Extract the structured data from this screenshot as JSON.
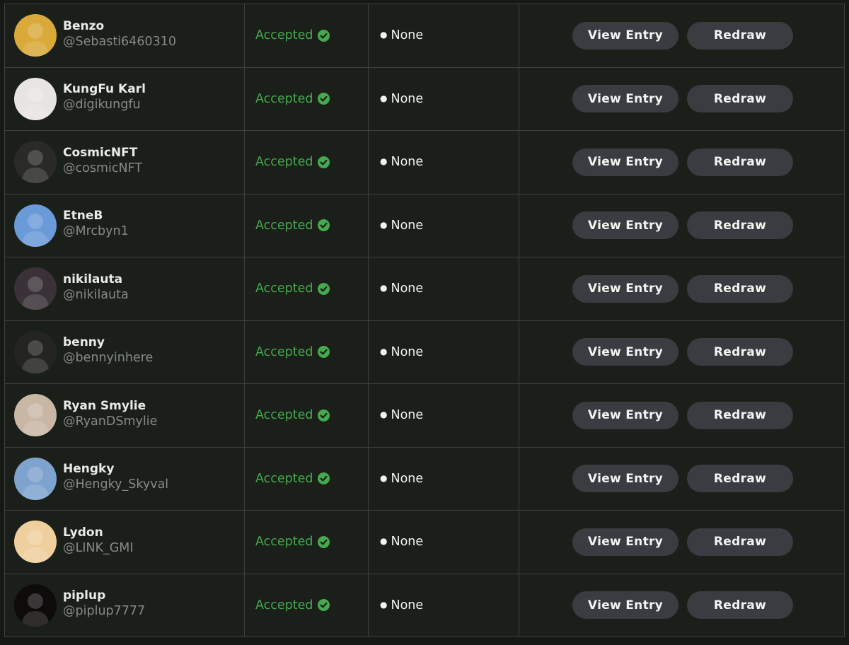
{
  "colors": {
    "background": "#1a1f19",
    "border": "#3c423d",
    "accepted": "#46a84f",
    "button": "#393d42"
  },
  "entries": [
    {
      "name": "Benzo",
      "handle": "@Sebasti6460310",
      "status": "Accepted",
      "other": "None",
      "view_label": "View Entry",
      "redraw_label": "Redraw",
      "avatar_color": "#d9a93a"
    },
    {
      "name": "KungFu Karl",
      "handle": "@digikungfu",
      "status": "Accepted",
      "other": "None",
      "view_label": "View Entry",
      "redraw_label": "Redraw",
      "avatar_color": "#e8e4e2"
    },
    {
      "name": "CosmicNFT",
      "handle": "@cosmicNFT",
      "status": "Accepted",
      "other": "None",
      "view_label": "View Entry",
      "redraw_label": "Redraw",
      "avatar_color": "#2a2a28"
    },
    {
      "name": "EtneB",
      "handle": "@Mrcbyn1",
      "status": "Accepted",
      "other": "None",
      "view_label": "View Entry",
      "redraw_label": "Redraw",
      "avatar_color": "#6a9ad8"
    },
    {
      "name": "nikilauta",
      "handle": "@nikilauta",
      "status": "Accepted",
      "other": "None",
      "view_label": "View Entry",
      "redraw_label": "Redraw",
      "avatar_color": "#3a3236"
    },
    {
      "name": "benny",
      "handle": "@bennyinhere",
      "status": "Accepted",
      "other": "None",
      "view_label": "View Entry",
      "redraw_label": "Redraw",
      "avatar_color": "#242422"
    },
    {
      "name": "Ryan Smylie",
      "handle": "@RyanDSmylie",
      "status": "Accepted",
      "other": "None",
      "view_label": "View Entry",
      "redraw_label": "Redraw",
      "avatar_color": "#c9b7a6"
    },
    {
      "name": "Hengky",
      "handle": "@Hengky_Skyval",
      "status": "Accepted",
      "other": "None",
      "view_label": "View Entry",
      "redraw_label": "Redraw",
      "avatar_color": "#7fa3cf"
    },
    {
      "name": "Lydon",
      "handle": "@LINK_GMI",
      "status": "Accepted",
      "other": "None",
      "view_label": "View Entry",
      "redraw_label": "Redraw",
      "avatar_color": "#efcf9e"
    },
    {
      "name": "piplup",
      "handle": "@piplup7777",
      "status": "Accepted",
      "other": "None",
      "view_label": "View Entry",
      "redraw_label": "Redraw",
      "avatar_color": "#0e0c0b"
    }
  ]
}
